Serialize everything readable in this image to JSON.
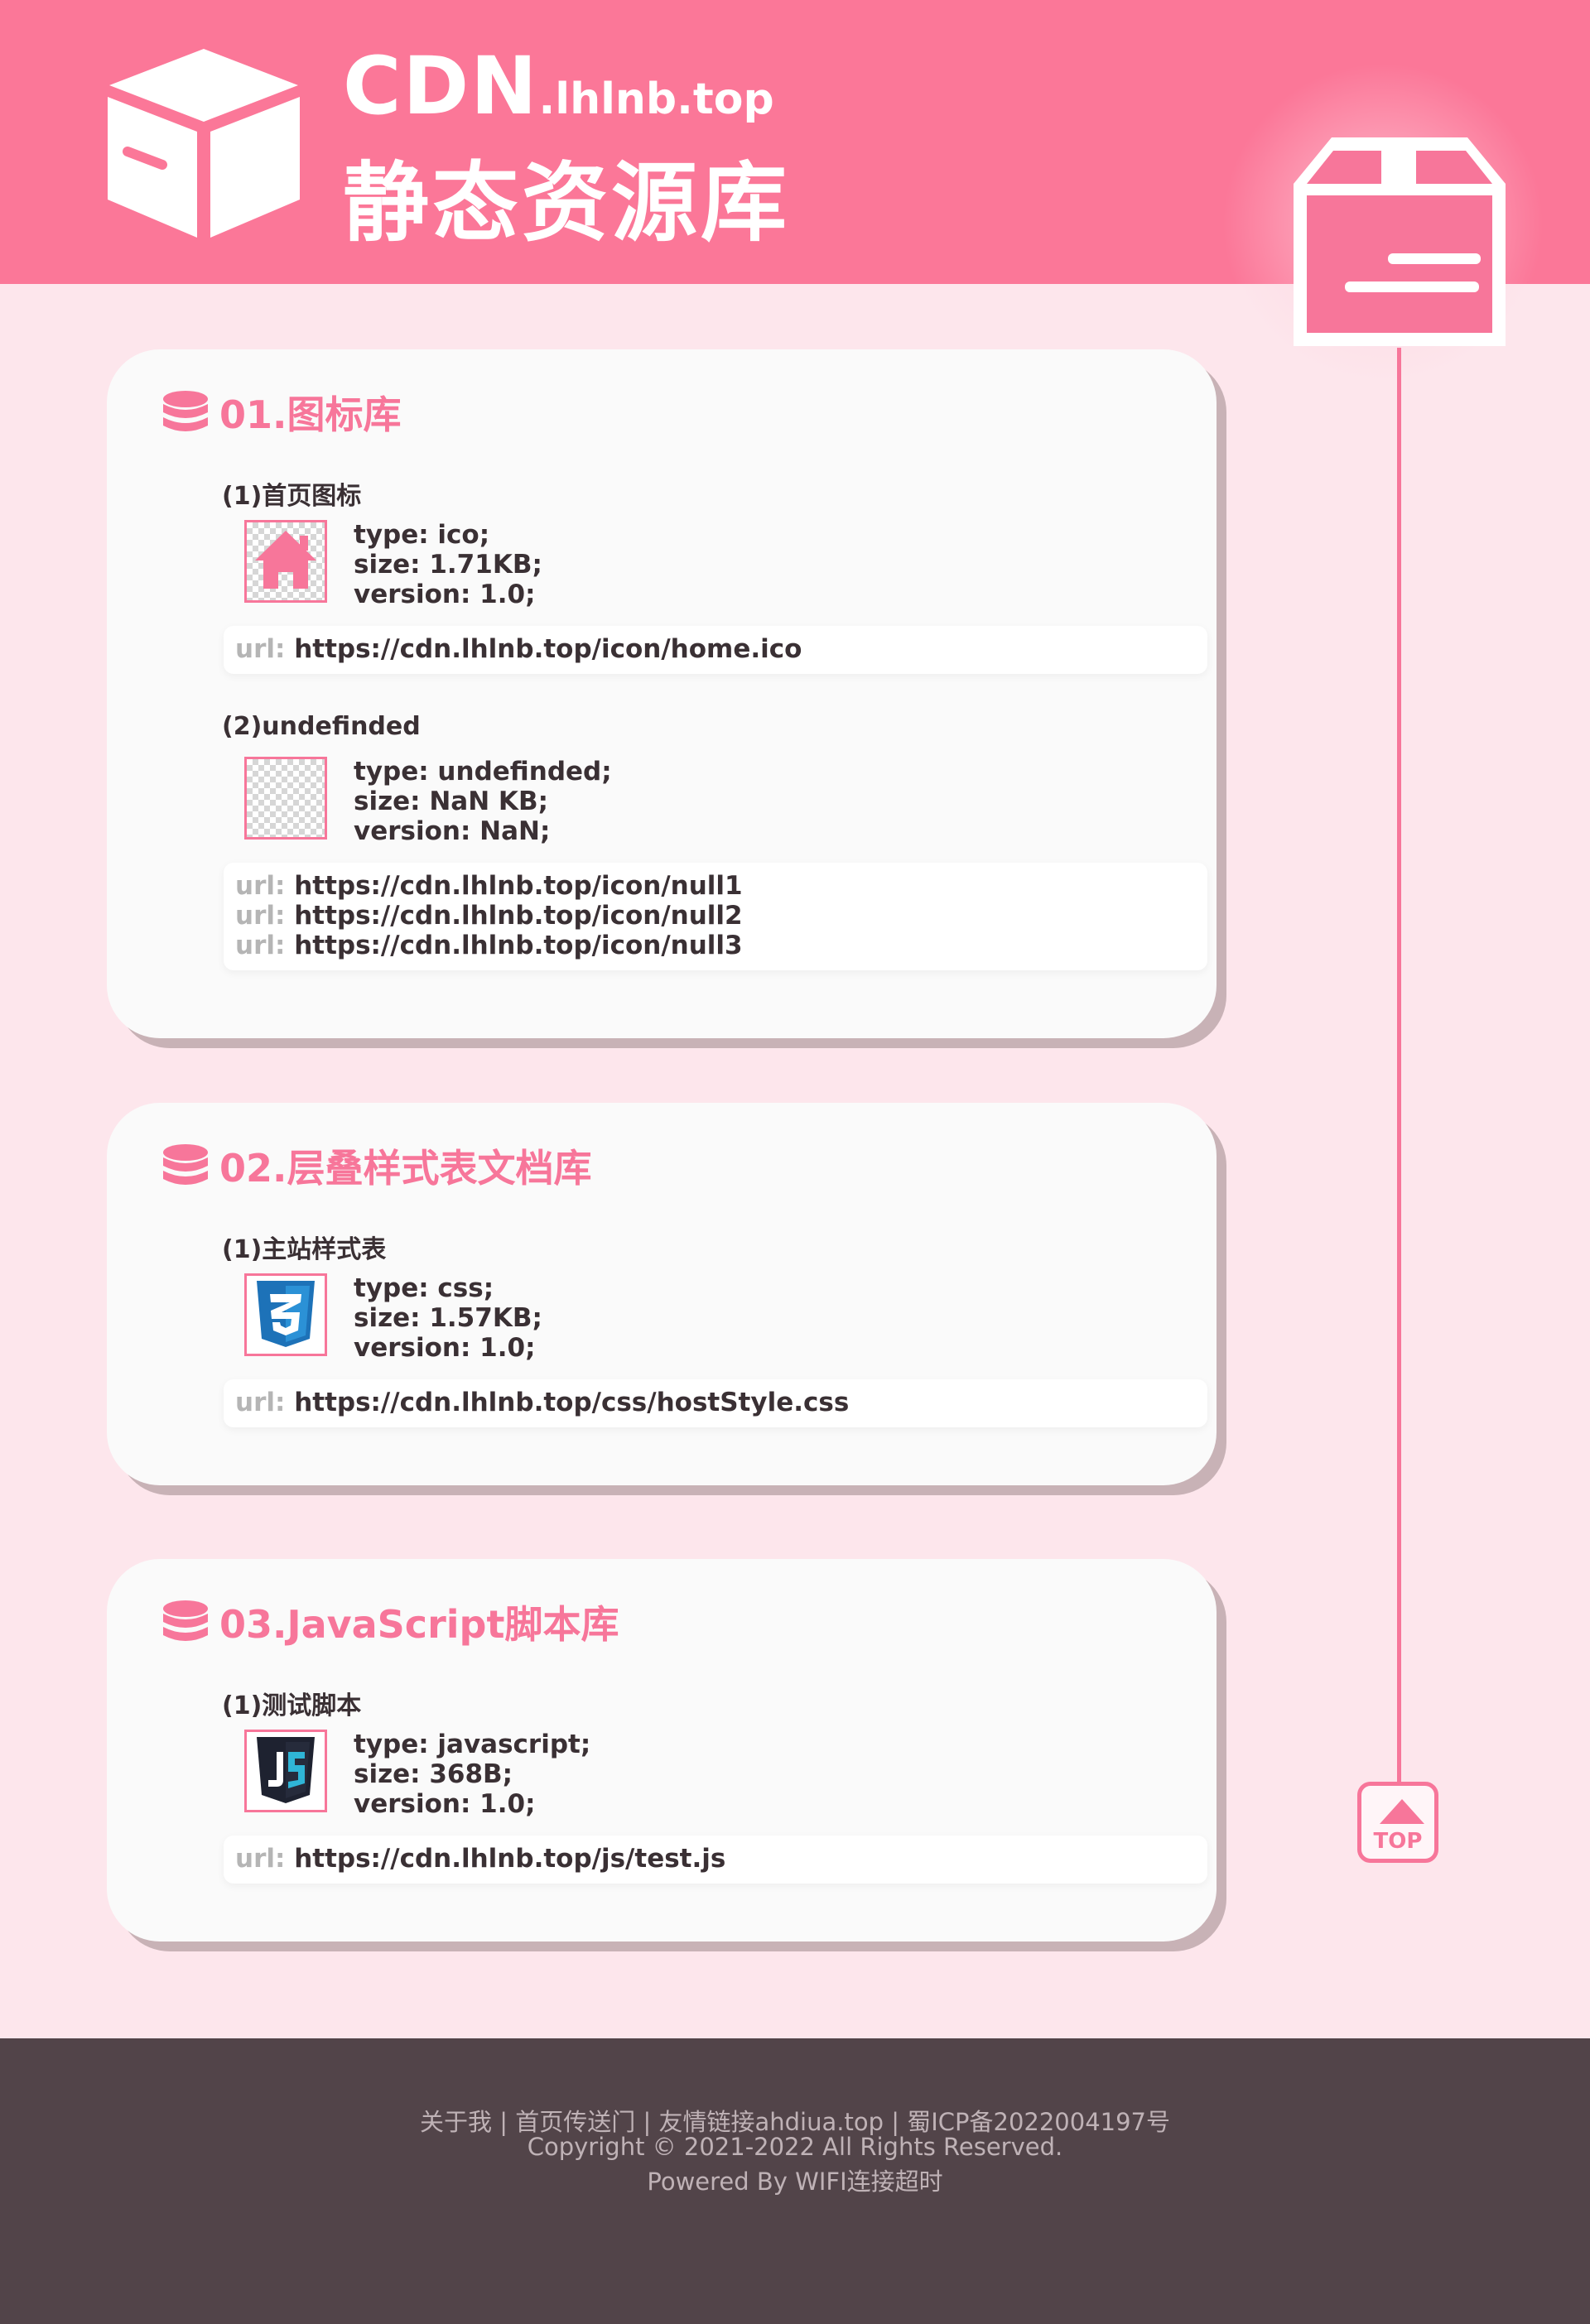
{
  "header": {
    "brand_big": "CDN",
    "brand_small": ".lhlnb.top",
    "subtitle": "静态资源库"
  },
  "top_button": {
    "label": "TOP"
  },
  "sections": [
    {
      "title": "01.图标库",
      "items": [
        {
          "title": "(1)首页图标",
          "thumb_icon": "home-icon",
          "type": "type: ico;",
          "size": "size: 1.71KB;",
          "version": "version: 1.0;",
          "urls": [
            "https://cdn.lhlnb.top/icon/home.ico"
          ]
        },
        {
          "title": "(2)undefinded",
          "thumb_icon": "empty-transparent",
          "type": "type: undefinded;",
          "size": "size: NaN KB;",
          "version": "version: NaN;",
          "urls": [
            "https://cdn.lhlnb.top/icon/null1",
            "https://cdn.lhlnb.top/icon/null2",
            "https://cdn.lhlnb.top/icon/null3"
          ]
        }
      ]
    },
    {
      "title": "02.层叠样式表文档库",
      "items": [
        {
          "title": "(1)主站样式表",
          "thumb_icon": "css3-icon",
          "type": "type: css;",
          "size": "size: 1.57KB;",
          "version": "version: 1.0;",
          "urls": [
            "https://cdn.lhlnb.top/css/hostStyle.css"
          ]
        }
      ]
    },
    {
      "title": "03.JavaScript脚本库",
      "items": [
        {
          "title": "(1)测试脚本",
          "thumb_icon": "js-icon",
          "type": "type: javascript;",
          "size": "size: 368B;",
          "version": "version: 1.0;",
          "urls": [
            "https://cdn.lhlnb.top/js/test.js"
          ]
        }
      ]
    }
  ],
  "url_key": "url:",
  "footer": {
    "links": [
      "关于我",
      "首页传送门",
      "友情链接ahdiua.top",
      "蜀ICP备2022004197号"
    ],
    "separator": " | ",
    "copyright": "Copyright © 2021-2022 All Rights Reserved.",
    "powered": "Powered By WIFI连接超时"
  },
  "colors": {
    "accent": "#f7769a",
    "header_bg": "#fb7798",
    "page_bg": "#fde6ec",
    "card_bg": "#fafafa",
    "footer_bg": "#524449",
    "css3_blue": "#1d72b8",
    "js_navy": "#1e2230",
    "js_cyan": "#2fb5d6"
  }
}
